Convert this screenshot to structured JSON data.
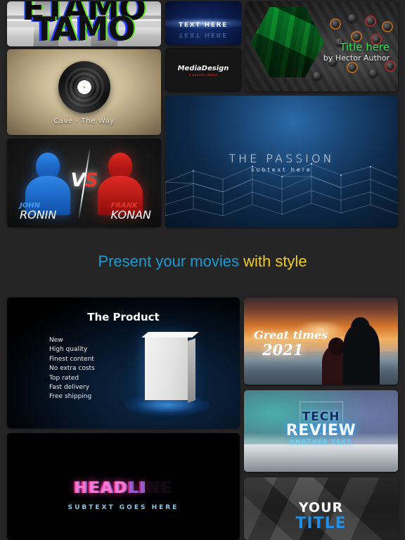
{
  "page": {
    "background_color": "#252525"
  },
  "headline": {
    "part1": "Present your movies",
    "part2": "with style",
    "color1": "#1d9bd1",
    "color2": "#f2cc20"
  },
  "cards": {
    "glitch_logo": {
      "name": "glitch-logo-card",
      "word_top": "ETAMO",
      "word_bottom": "TAMO"
    },
    "vinyl": {
      "name": "vinyl-record-card",
      "track_label": "Cave - The Way"
    },
    "versus": {
      "name": "versus-card",
      "vs_v": "V",
      "vs_s": "S",
      "left_first": "JOHN",
      "left_last": "RONIN",
      "right_first": "FRANK",
      "right_last": "KONAN",
      "left_color": "#2f86e8",
      "right_color": "#e02a22"
    },
    "text_here": {
      "name": "text-here-card",
      "title": "TEXT HERE",
      "reflection": "TEXT HERE"
    },
    "media_design": {
      "name": "media-design-card",
      "brand": "MediaDesign",
      "tagline": "a quality choice",
      "tagline_color": "#d41515"
    },
    "mixer": {
      "name": "audio-mixer-card",
      "title": "Title here",
      "byline": "by Hector Author",
      "title_color": "#2ce34e"
    },
    "passion": {
      "name": "the-passion-card",
      "title": "THE PASSION",
      "subtitle": "subtext here"
    },
    "product": {
      "name": "the-product-card",
      "title": "The Product",
      "features": [
        "New",
        "High quality",
        "Finest content",
        "No extra costs",
        "Top rated",
        "Fast delivery",
        "Free shipping"
      ]
    },
    "headline_glitch": {
      "name": "headline-glitch-card",
      "title_visible": "HEAD",
      "title_glitch": "LI",
      "title_faded": "NE",
      "subtitle": "SUBTEXT GOES HERE"
    },
    "great_times": {
      "name": "great-times-card",
      "line1": "Great times",
      "line2": "2021"
    },
    "tech_review": {
      "name": "tech-review-card",
      "line1": "TECH",
      "line2": "REVIEW",
      "line3": "ANOTHER TEXT"
    },
    "your_title": {
      "name": "your-title-card",
      "line1": "YOUR",
      "line2": "TITLE",
      "line2_color": "#1f8fe8"
    }
  }
}
